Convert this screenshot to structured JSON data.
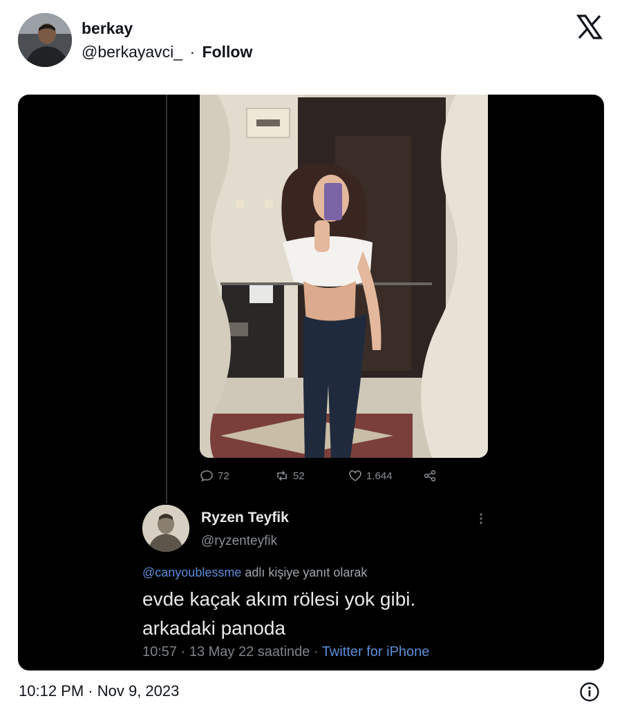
{
  "author": {
    "name": "berkay",
    "handle": "@berkayavci_",
    "separator": "·",
    "follow_label": "Follow"
  },
  "brand_icon": "x-logo-icon",
  "embedded_tweet": {
    "stats": {
      "replies": "72",
      "retweets": "52",
      "likes": "1.644"
    },
    "reply": {
      "name": "Ryzen Teyfik",
      "handle": "@ryzenteyfik",
      "reply_to_mention": "@canyoublessme",
      "reply_to_suffix": " adlı kişiye yanıt olarak",
      "text_line1": "evde kaçak akım rölesi yok gibi.",
      "text_line2": "arkadaki panoda",
      "time": "10:57 · 13 May 22 saatinde · ",
      "source": "Twitter for iPhone"
    },
    "colors": {
      "background": "#000000",
      "link": "#5b8dd9",
      "text": "#e7e9ea",
      "muted": "#8b9095"
    }
  },
  "timestamp": "10:12 PM · Nov 9, 2023",
  "info_icon": "info-icon"
}
